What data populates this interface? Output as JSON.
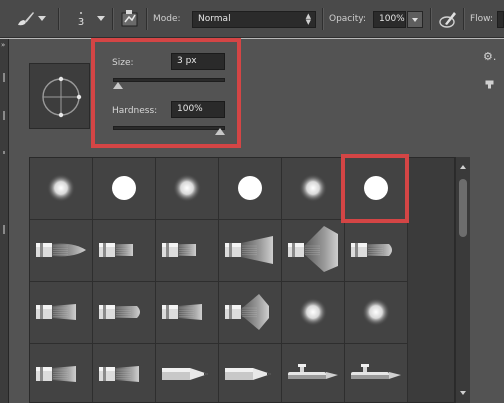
{
  "options_bar": {
    "brush_size_value": "3",
    "mode_label": "Mode:",
    "mode_value": "Normal",
    "opacity_label": "Opacity:",
    "opacity_value": "100%",
    "flow_label": "Flow:"
  },
  "brush_panel": {
    "size_label": "Size:",
    "size_value": "3 px",
    "size_fraction": 0.0,
    "hardness_label": "Hardness:",
    "hardness_value": "100%",
    "hardness_fraction": 1.0
  },
  "brush_presets": [
    [
      "soft-round",
      "hard-round",
      "soft-round",
      "hard-round",
      "soft-round",
      "hard-round"
    ],
    [
      "flat-brush",
      "round-bristle",
      "round-bristle",
      "flat-fan",
      "fan-brush",
      "round-blunt"
    ],
    [
      "flat-bristle",
      "round-blunt",
      "flat-bristle",
      "fan-small",
      "soft-round",
      "soft-round"
    ],
    [
      "flat-bristle",
      "flat-bristle",
      "pencil",
      "pencil",
      "airbrush",
      "airbrush"
    ]
  ],
  "selected_preset": "hard-round",
  "colors": {
    "highlight": "#d44545",
    "panel_bg": "#535353",
    "bar_bg": "#4a4a4a"
  },
  "icons": {
    "tool": "brush-icon",
    "panel_toggle": "brush-panel-icon",
    "pressure": "tablet-pressure-icon",
    "settings": "gear-icon"
  }
}
